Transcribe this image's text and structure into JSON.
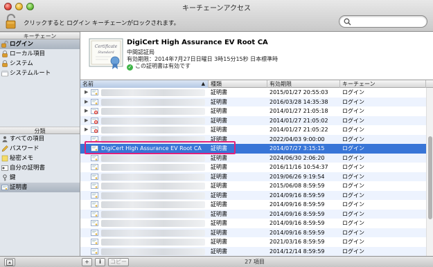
{
  "window": {
    "title": "キーチェーンアクセス",
    "lock_hint": "クリックすると ログイン キーチェーンがロックされます。"
  },
  "sidebar": {
    "keychains_header": "キーチェーン",
    "keychains": [
      {
        "label": "ログイン",
        "icon": "lock-open-icon",
        "selected": true
      },
      {
        "label": "ローカル項目",
        "icon": "lock-icon",
        "selected": false
      },
      {
        "label": "システム",
        "icon": "lock-icon",
        "selected": false
      },
      {
        "label": "システムルート",
        "icon": "folder-lock-icon",
        "selected": false
      }
    ],
    "categories_header": "分類",
    "categories": [
      {
        "label": "すべての項目",
        "icon": "people-icon",
        "selected": false
      },
      {
        "label": "パスワード",
        "icon": "pencil-icon",
        "selected": false
      },
      {
        "label": "秘密メモ",
        "icon": "note-icon",
        "selected": false
      },
      {
        "label": "自分の証明書",
        "icon": "my-cert-icon",
        "selected": false
      },
      {
        "label": "鍵",
        "icon": "key-icon",
        "selected": false
      },
      {
        "label": "証明書",
        "icon": "certificate-icon",
        "selected": true
      }
    ]
  },
  "detail": {
    "name": "DigiCert High Assurance EV Root CA",
    "issuer_type": "中間認証局",
    "expiry": "有効期限：2014年7月27日日曜日 3時15分15秒 日本標準時",
    "validity": "この証明書は有効です",
    "badge_text": "Certificate Standard"
  },
  "table": {
    "columns": {
      "name": "名前",
      "kind": "種類",
      "expires": "有効期限",
      "keychain": "キーチェーン"
    },
    "rows": [
      {
        "name": "",
        "kind": "証明書",
        "expires": "2015/01/27 20:55:03",
        "keychain": "ログイン",
        "expandable": true,
        "icon": "certificate-icon"
      },
      {
        "name": "",
        "kind": "証明書",
        "expires": "2016/03/28 14:35:38",
        "keychain": "ログイン",
        "expandable": true,
        "icon": "certificate-icon"
      },
      {
        "name": "",
        "kind": "証明書",
        "expires": "2014/01/27 21:05:18",
        "keychain": "ログイン",
        "expandable": true,
        "icon": "certificate-invalid-icon"
      },
      {
        "name": "",
        "kind": "証明書",
        "expires": "2014/01/27 21:05:02",
        "keychain": "ログイン",
        "expandable": true,
        "icon": "certificate-invalid-icon"
      },
      {
        "name": "",
        "kind": "証明書",
        "expires": "2014/01/27 21:05:22",
        "keychain": "ログイン",
        "expandable": true,
        "icon": "certificate-invalid-icon"
      },
      {
        "name": "",
        "kind": "証明書",
        "expires": "2022/04/03 9:00:00",
        "keychain": "ログイン",
        "expandable": false,
        "icon": "certificate-icon"
      },
      {
        "name": "DigiCert High Assurance EV Root CA",
        "kind": "証明書",
        "expires": "2014/07/27 3:15:15",
        "keychain": "ログイン",
        "expandable": false,
        "icon": "certificate-icon",
        "selected": true
      },
      {
        "name": "",
        "kind": "証明書",
        "expires": "2024/06/30 2:06:20",
        "keychain": "ログイン",
        "expandable": false,
        "icon": "certificate-icon"
      },
      {
        "name": "",
        "kind": "証明書",
        "expires": "2016/11/16 10:54:37",
        "keychain": "ログイン",
        "expandable": false,
        "icon": "certificate-icon"
      },
      {
        "name": "",
        "kind": "証明書",
        "expires": "2019/06/26 9:19:54",
        "keychain": "ログイン",
        "expandable": false,
        "icon": "certificate-icon"
      },
      {
        "name": "",
        "kind": "証明書",
        "expires": "2015/06/08 8:59:59",
        "keychain": "ログイン",
        "expandable": false,
        "icon": "certificate-icon"
      },
      {
        "name": "",
        "kind": "証明書",
        "expires": "2014/09/16 8:59:59",
        "keychain": "ログイン",
        "expandable": false,
        "icon": "certificate-icon"
      },
      {
        "name": "",
        "kind": "証明書",
        "expires": "2014/09/16 8:59:59",
        "keychain": "ログイン",
        "expandable": false,
        "icon": "certificate-icon"
      },
      {
        "name": "",
        "kind": "証明書",
        "expires": "2014/09/16 8:59:59",
        "keychain": "ログイン",
        "expandable": false,
        "icon": "certificate-icon"
      },
      {
        "name": "",
        "kind": "証明書",
        "expires": "2014/09/16 8:59:59",
        "keychain": "ログイン",
        "expandable": false,
        "icon": "certificate-icon"
      },
      {
        "name": "",
        "kind": "証明書",
        "expires": "2014/09/16 8:59:59",
        "keychain": "ログイン",
        "expandable": false,
        "icon": "certificate-icon"
      },
      {
        "name": "",
        "kind": "証明書",
        "expires": "2021/03/16 8:59:59",
        "keychain": "ログイン",
        "expandable": false,
        "icon": "certificate-icon"
      },
      {
        "name": "",
        "kind": "証明書",
        "expires": "2014/12/14 8:59:59",
        "keychain": "ログイン",
        "expandable": false,
        "icon": "certificate-icon"
      },
      {
        "name": "",
        "kind": "証明書",
        "expires": "2021/11/08 8:59:59",
        "keychain": "ログイン",
        "expandable": false,
        "icon": "certificate-icon"
      }
    ]
  },
  "bottom": {
    "add_label": "+",
    "info_label": "i",
    "copy_label": "コピー",
    "item_count": "27 項目"
  },
  "colors": {
    "selection": "#3875d7",
    "highlight_box": "#e0207a",
    "sidebar_bg": "#e1e6ec"
  }
}
